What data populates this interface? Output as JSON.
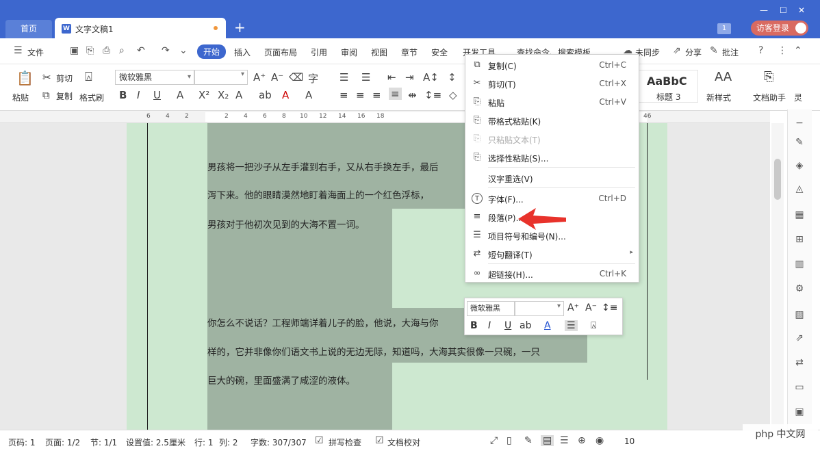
{
  "titlebar": {
    "home_tab": "首页",
    "doc_tab": "文字文稿1",
    "new_tab": "+",
    "count_badge": "1",
    "login": "访客登录",
    "accent": "#3d67ce"
  },
  "menubar": {
    "file": "文件",
    "items": [
      "开始",
      "插入",
      "页面布局",
      "引用",
      "审阅",
      "视图",
      "章节",
      "安全",
      "开发工具"
    ],
    "search": "查找命令、搜索模板",
    "sync": "未同步",
    "share": "分享",
    "annotate": "批注"
  },
  "ribbon": {
    "paste": "粘贴",
    "cut": "剪切",
    "copy": "复制",
    "format_painter": "格式刷",
    "font_name": "微软雅黑",
    "font_size": "",
    "style_preview": "AaBbC",
    "style_name": "标题 3",
    "new_style": "新样式",
    "doc_assistant": "文档助手",
    "more": "灵"
  },
  "ruler": {
    "ticks": [
      "6",
      "4",
      "2",
      "2",
      "4",
      "6",
      "8",
      "10",
      "12",
      "14",
      "16",
      "18",
      "46"
    ]
  },
  "document": {
    "lines": [
      "男孩将一把沙子从左手灌到右手，又从右手换左手，最后",
      "泻下来。他的眼睛漠然地盯着海面上的一个红色浮标，",
      "男孩对于他初次见到的大海不置一词。",
      "你怎么不说话？工程师端详着儿子的脸，他说，大海与你",
      "样的，它并非像你们语文书上说的无边无际，知道吗，大海其实很像一只碗，一只",
      "巨大的碗，里面盛满了咸涩的液体。"
    ]
  },
  "context_menu": {
    "items": [
      {
        "label": "复制(C)",
        "shortcut": "Ctrl+C",
        "icon": "copy-icon"
      },
      {
        "label": "剪切(T)",
        "shortcut": "Ctrl+X",
        "icon": "scissors-icon"
      },
      {
        "label": "粘贴",
        "shortcut": "Ctrl+V",
        "icon": "paste-icon"
      },
      {
        "label": "带格式粘贴(K)",
        "shortcut": "",
        "icon": "paste-format-icon"
      },
      {
        "label": "只粘贴文本(T)",
        "shortcut": "",
        "icon": "paste-text-icon"
      },
      {
        "label": "选择性粘贴(S)...",
        "shortcut": "",
        "icon": "paste-special-icon"
      },
      {
        "label": "汉字重选(V)",
        "shortcut": "",
        "icon": ""
      },
      {
        "label": "字体(F)...",
        "shortcut": "Ctrl+D",
        "icon": "font-icon"
      },
      {
        "label": "段落(P)...",
        "shortcut": "",
        "icon": "paragraph-icon"
      },
      {
        "label": "项目符号和编号(N)...",
        "shortcut": "",
        "icon": "list-icon"
      },
      {
        "label": "短句翻译(T)",
        "shortcut": "",
        "icon": "translate-icon"
      },
      {
        "label": "超链接(H)...",
        "shortcut": "Ctrl+K",
        "icon": "link-icon"
      }
    ]
  },
  "mini_toolbar": {
    "font_name": "微软雅黑",
    "font_size": ""
  },
  "statusbar": {
    "page_num": "页码: 1",
    "page_of": "页面: 1/2",
    "section": "节: 1/1",
    "setting": "设置值: 2.5厘米",
    "row": "行: 1",
    "col": "列: 2",
    "word_count": "字数: 307/307",
    "spell_check": "拼写检查",
    "doc_proof": "文档校对",
    "zoom": "10"
  },
  "watermark": "php 中文网"
}
